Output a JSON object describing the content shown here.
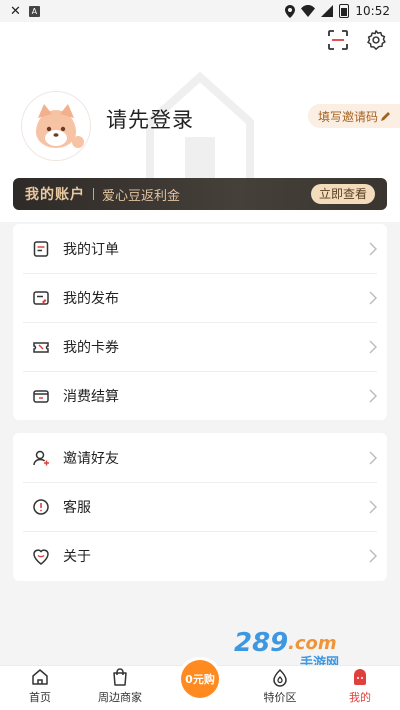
{
  "status_bar": {
    "left_icons": [
      "close-icon",
      "a-icon"
    ],
    "time": "10:52"
  },
  "header": {
    "login_text": "请先登录",
    "invite_label": "填写邀请码"
  },
  "account_bar": {
    "title": "我的账户",
    "subtitle": "爱心豆返利金",
    "view_button": "立即查看"
  },
  "menu_group_1": [
    {
      "label": "我的订单",
      "icon": "order-icon"
    },
    {
      "label": "我的发布",
      "icon": "publish-icon"
    },
    {
      "label": "我的卡券",
      "icon": "coupon-icon"
    },
    {
      "label": "消费结算",
      "icon": "settlement-icon"
    }
  ],
  "menu_group_2": [
    {
      "label": "邀请好友",
      "icon": "invite-friend-icon"
    },
    {
      "label": "客服",
      "icon": "customer-service-icon"
    },
    {
      "label": "关于",
      "icon": "about-icon"
    }
  ],
  "bottom_nav": {
    "items": [
      {
        "label": "首页",
        "icon": "home-icon"
      },
      {
        "label": "周边商家",
        "icon": "shop-bag-icon"
      },
      {
        "label": "0元购",
        "icon": "zero-purchase-badge"
      },
      {
        "label": "特价区",
        "icon": "special-price-icon"
      },
      {
        "label": "我的",
        "icon": "mine-icon"
      }
    ],
    "active_index": 4,
    "accent_color": "#e0403c"
  },
  "watermark": "289.com 手游网"
}
